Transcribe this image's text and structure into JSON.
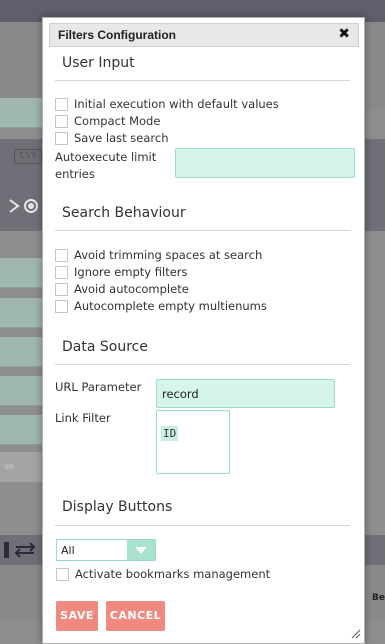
{
  "modal": {
    "title": "Filters Configuration",
    "close_icon": "close-icon"
  },
  "user_input": {
    "title": "User Input",
    "checkboxes": [
      {
        "label": "Initial execution with default values",
        "checked": false
      },
      {
        "label": "Compact Mode",
        "checked": false
      },
      {
        "label": "Save last search",
        "checked": false
      }
    ],
    "autoexecute_label_1": "Autoexecute limit",
    "autoexecute_label_2": "entries",
    "autoexecute_value": ""
  },
  "search_behaviour": {
    "title": "Search Behaviour",
    "checkboxes": [
      {
        "label": "Avoid trimming spaces at search",
        "checked": false
      },
      {
        "label": "Ignore empty filters",
        "checked": false
      },
      {
        "label": "Avoid autocomplete",
        "checked": false
      },
      {
        "label": "Autocomplete empty multienums",
        "checked": false
      }
    ]
  },
  "data_source": {
    "title": "Data Source",
    "url_parameter_label": "URL Parameter",
    "url_parameter_value": "record",
    "link_filter_label": "Link Filter",
    "link_filter_items": [
      "ID"
    ]
  },
  "display_buttons": {
    "title": "Display Buttons",
    "select_value": "All",
    "bookmarks_label": "Activate bookmarks management",
    "bookmarks_checked": false
  },
  "actions": {
    "save_label": "SAVE",
    "cancel_label": "CANCEL"
  },
  "background": {
    "css_badge": "CSS",
    "pale_text": "on",
    "edge_text": "Be"
  },
  "colors": {
    "accent_mint": "#d5f4ea",
    "button_salmon": "#f08a80",
    "overlay": "#8e8e8e"
  }
}
